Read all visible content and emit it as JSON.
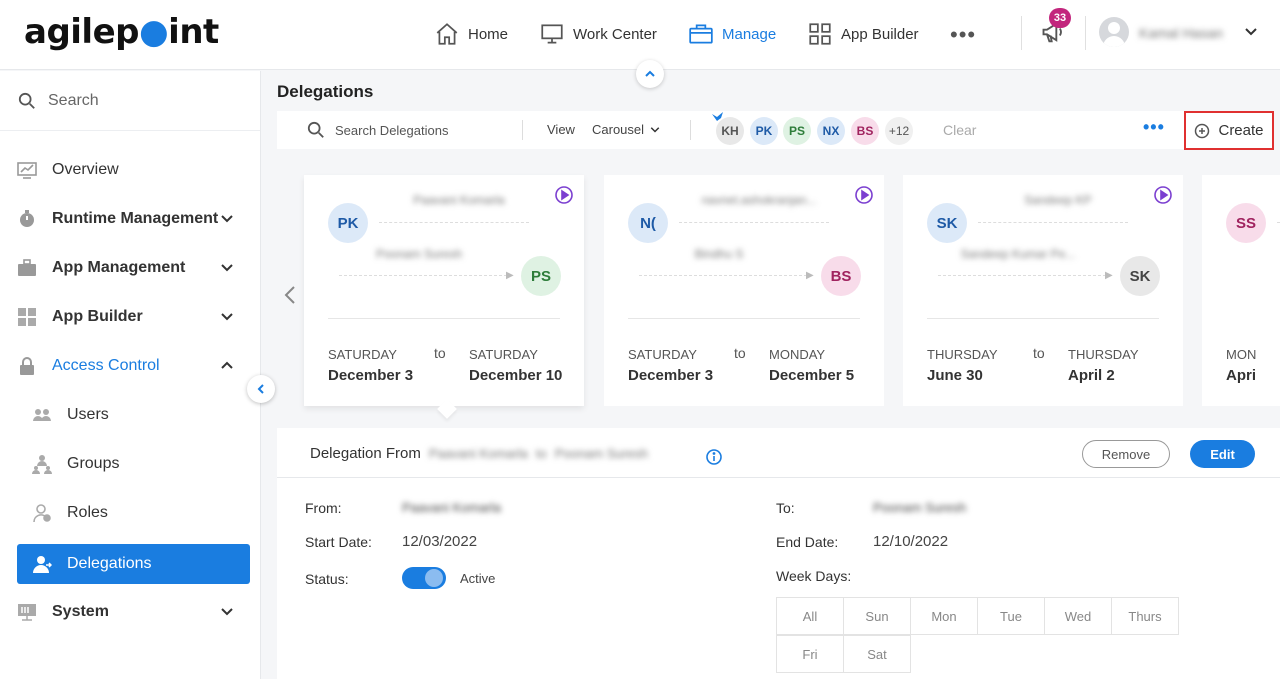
{
  "brand": {
    "logo_text_a": "agilep",
    "logo_text_b": "int"
  },
  "topnav": {
    "items": [
      {
        "label": "Home",
        "icon": "home-icon"
      },
      {
        "label": "Work Center",
        "icon": "monitor-icon"
      },
      {
        "label": "Manage",
        "icon": "briefcase-icon",
        "active": true
      },
      {
        "label": "App Builder",
        "icon": "grid-icon"
      }
    ],
    "more": "•••",
    "notification_count": "33",
    "user_name": "Kamal Hasan"
  },
  "sidebar": {
    "search_placeholder": "Search",
    "items": [
      {
        "label": "Overview",
        "icon": "chart-icon"
      },
      {
        "label": "Runtime Management",
        "icon": "stopwatch-icon"
      },
      {
        "label": "App Management",
        "icon": "toolbox-icon"
      },
      {
        "label": "App Builder",
        "icon": "dashboard-icon"
      },
      {
        "label": "Access Control",
        "icon": "lock-icon"
      },
      {
        "label": "Users",
        "icon": "users-icon"
      },
      {
        "label": "Groups",
        "icon": "groups-icon"
      },
      {
        "label": "Roles",
        "icon": "roles-icon"
      },
      {
        "label": "Delegations",
        "icon": "delegation-icon"
      },
      {
        "label": "System",
        "icon": "server-icon"
      }
    ]
  },
  "page": {
    "title": "Delegations"
  },
  "toolbar": {
    "search_placeholder": "Search Delegations",
    "view_label": "View",
    "view_value": "Carousel",
    "chips": [
      {
        "initials": "KH",
        "bg": "#e8e8e8",
        "fg": "#555"
      },
      {
        "initials": "PK",
        "bg": "#dce9f8",
        "fg": "#1e5aa6"
      },
      {
        "initials": "PS",
        "bg": "#dff2e3",
        "fg": "#2e7d3a"
      },
      {
        "initials": "NX",
        "bg": "#dce9f8",
        "fg": "#1e5aa6"
      },
      {
        "initials": "BS",
        "bg": "#f8dcea",
        "fg": "#a0235f"
      }
    ],
    "more_count": "+12",
    "clear_label": "Clear",
    "create_label": "Create"
  },
  "cards": [
    {
      "from_initials": "PK",
      "from_bg": "#dce9f8",
      "from_fg": "#1e5aa6",
      "from_name": "Paavani Komarla",
      "to_initials": "PS",
      "to_bg": "#dff2e3",
      "to_fg": "#2e7d3a",
      "to_name": "Poonam Suresh",
      "start_day": "SATURDAY",
      "start_date": "December 3",
      "to_word": "to",
      "end_day": "SATURDAY",
      "end_date": "December 10"
    },
    {
      "from_initials": "N(",
      "from_bg": "#dce9f8",
      "from_fg": "#1e5aa6",
      "from_name": "navnet.ashokranjan...",
      "to_initials": "BS",
      "to_bg": "#f8dcea",
      "to_fg": "#a0235f",
      "to_name": "Bindhu S",
      "start_day": "SATURDAY",
      "start_date": "December 3",
      "to_word": "to",
      "end_day": "MONDAY",
      "end_date": "December 5"
    },
    {
      "from_initials": "SK",
      "from_bg": "#dce9f8",
      "from_fg": "#1e5aa6",
      "from_name": "Sandeep KP",
      "to_initials": "SK",
      "to_bg": "#e8e8e8",
      "to_fg": "#444",
      "to_name": "Sandeep Kumar Pe...",
      "start_day": "THURSDAY",
      "start_date": "June 30",
      "to_word": "to",
      "end_day": "THURSDAY",
      "end_date": "April 2"
    },
    {
      "from_initials": "SS",
      "from_bg": "#f8dcea",
      "from_fg": "#a0235f",
      "from_name": "",
      "to_initials": "",
      "to_bg": "#fff",
      "to_fg": "#444",
      "to_name": "",
      "start_day": "MON",
      "start_date": "Apri",
      "to_word": "",
      "end_day": "",
      "end_date": ""
    }
  ],
  "detail": {
    "title_prefix": "Delegation From",
    "title_from": "Paavani Komarla",
    "title_to_word": "to",
    "title_to": "Poonam Suresh",
    "remove_label": "Remove",
    "edit_label": "Edit",
    "from_label": "From:",
    "from_value": "Paavani Komarla",
    "to_label": "To:",
    "to_value": "Poonam Suresh",
    "start_label": "Start Date:",
    "start_value": "12/03/2022",
    "end_label": "End Date:",
    "end_value": "12/10/2022",
    "status_label": "Status:",
    "status_value": "Active",
    "weekdays_label": "Week Days:",
    "weekdays": [
      "All",
      "Sun",
      "Mon",
      "Tue",
      "Wed",
      "Thurs",
      "Fri",
      "Sat"
    ]
  }
}
